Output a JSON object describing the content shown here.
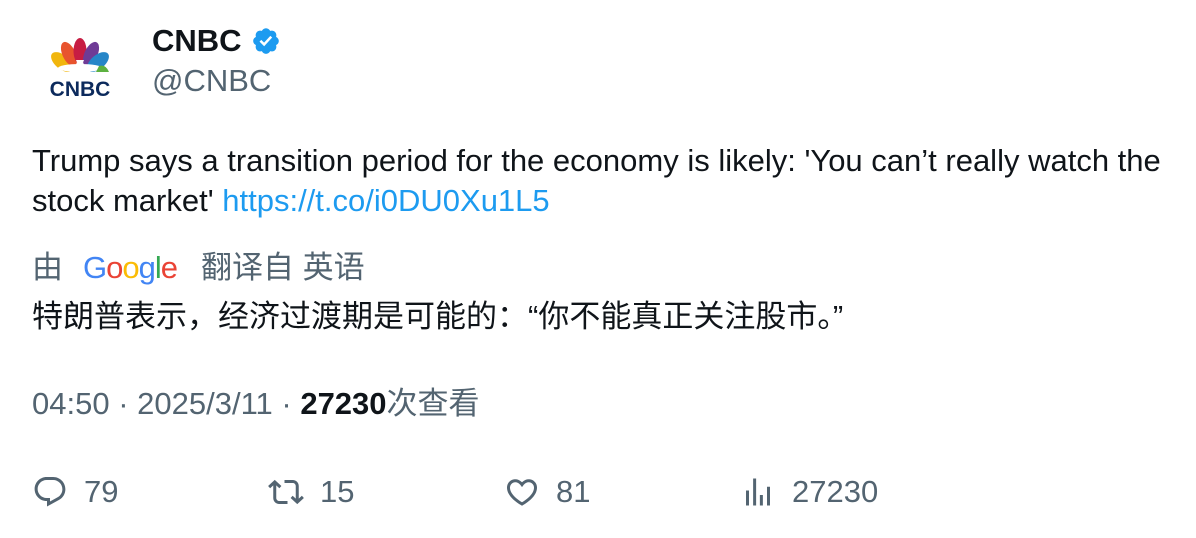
{
  "author": {
    "display_name": "CNBC",
    "handle": "@CNBC",
    "logo_text": "CNBC",
    "verified_icon": "verified-badge-icon",
    "verified_color": "#1d9bf0"
  },
  "tweet": {
    "text": "Trump says a transition period for the economy is likely: 'You can’t really watch the stock market' ",
    "link": "https://t.co/i0DU0Xu1L5"
  },
  "translation": {
    "by_label": "由",
    "provider": "Google",
    "from_label": "翻译自 英语",
    "translated_text": "特朗普表示，经济过渡期是可能的：“你不能真正关注股市。”"
  },
  "meta": {
    "time": "04:50",
    "separator": "·",
    "date": "2025/3/11",
    "views_count": "27230",
    "views_label": "次查看"
  },
  "actions": {
    "reply_count": "79",
    "retweet_count": "15",
    "like_count": "81",
    "views_count": "27230"
  },
  "colors": {
    "text_primary": "#0f1419",
    "text_secondary": "#536471",
    "link": "#1d9bf0"
  }
}
